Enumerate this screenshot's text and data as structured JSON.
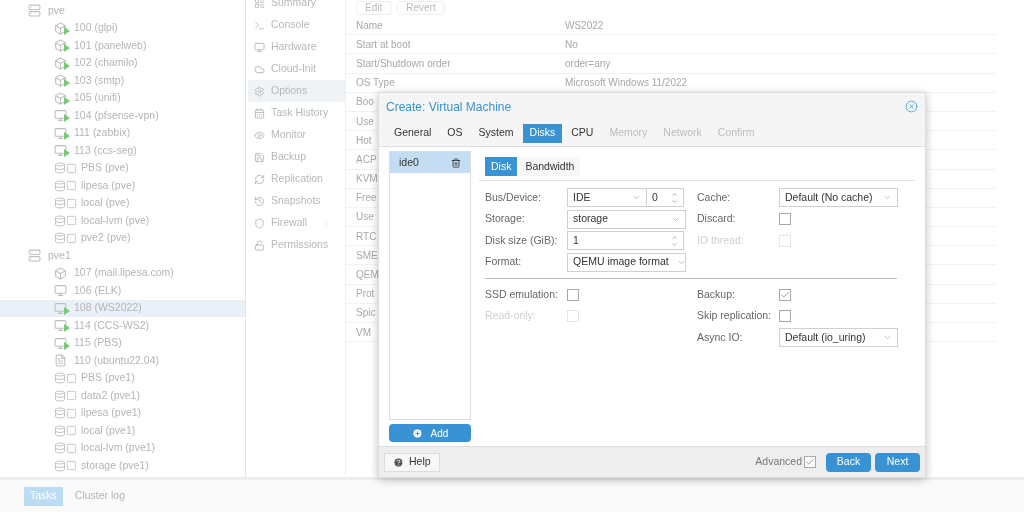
{
  "tree": [
    {
      "label": "pve",
      "kind": "node",
      "selected": false,
      "children": [
        {
          "label": "100 (glpi)",
          "kind": "container",
          "running": true,
          "selected": false
        },
        {
          "label": "101 (panelweb)",
          "kind": "container",
          "running": true,
          "selected": false
        },
        {
          "label": "102 (chamilo)",
          "kind": "container",
          "running": true,
          "selected": false
        },
        {
          "label": "103 (smtp)",
          "kind": "container",
          "running": true,
          "selected": false
        },
        {
          "label": "105 (unifi)",
          "kind": "container",
          "running": true,
          "selected": false
        },
        {
          "label": "104 (pfsense-vpn)",
          "kind": "vm",
          "running": true,
          "selected": false
        },
        {
          "label": "111 (zabbix)",
          "kind": "vm",
          "running": true,
          "selected": false
        },
        {
          "label": "113 (ccs-seg)",
          "kind": "vm",
          "running": true,
          "selected": false
        },
        {
          "label": "PBS (pve)",
          "kind": "storage",
          "selected": false
        },
        {
          "label": "lipesa (pve)",
          "kind": "storage",
          "selected": false
        },
        {
          "label": "local (pve)",
          "kind": "storage",
          "selected": false
        },
        {
          "label": "local-lvm (pve)",
          "kind": "storage",
          "selected": false
        },
        {
          "label": "pve2 (pve)",
          "kind": "storage",
          "selected": false
        }
      ]
    },
    {
      "label": "pve1",
      "kind": "node",
      "selected": false,
      "children": [
        {
          "label": "107 (mail.lipesa.com)",
          "kind": "container",
          "running": false,
          "selected": false
        },
        {
          "label": "106 (ELK)",
          "kind": "vm",
          "running": false,
          "selected": false
        },
        {
          "label": "108 (WS2022)",
          "kind": "vm",
          "running": true,
          "selected": true
        },
        {
          "label": "114 (CCS-WS2)",
          "kind": "vm",
          "running": true,
          "selected": false
        },
        {
          "label": "115 (PBS)",
          "kind": "vm",
          "running": true,
          "selected": false
        },
        {
          "label": "110 (ubuntu22.04)",
          "kind": "template",
          "selected": false
        },
        {
          "label": "PBS (pve1)",
          "kind": "storage",
          "selected": false
        },
        {
          "label": "data2 (pve1)",
          "kind": "storage",
          "selected": false
        },
        {
          "label": "lipesa (pve1)",
          "kind": "storage",
          "selected": false
        },
        {
          "label": "local (pve1)",
          "kind": "storage",
          "selected": false
        },
        {
          "label": "local-lvm (pve1)",
          "kind": "storage",
          "selected": false
        },
        {
          "label": "storage (pve1)",
          "kind": "storage",
          "selected": false
        }
      ]
    }
  ],
  "nav": [
    {
      "label": "Summary",
      "selected": false,
      "has_submenu": false
    },
    {
      "label": "Console",
      "selected": false,
      "has_submenu": false
    },
    {
      "label": "Hardware",
      "selected": false,
      "has_submenu": false
    },
    {
      "label": "Cloud-Init",
      "selected": false,
      "has_submenu": false
    },
    {
      "label": "Options",
      "selected": true,
      "has_submenu": false
    },
    {
      "label": "Task History",
      "selected": false,
      "has_submenu": false
    },
    {
      "label": "Monitor",
      "selected": false,
      "has_submenu": false
    },
    {
      "label": "Backup",
      "selected": false,
      "has_submenu": false
    },
    {
      "label": "Replication",
      "selected": false,
      "has_submenu": false
    },
    {
      "label": "Snapshots",
      "selected": false,
      "has_submenu": false
    },
    {
      "label": "Firewall",
      "selected": false,
      "has_submenu": true
    },
    {
      "label": "Permissions",
      "selected": false,
      "has_submenu": false
    }
  ],
  "toolbar": [
    "Edit",
    "Revert"
  ],
  "options": [
    {
      "name": "Name",
      "value": "WS2022"
    },
    {
      "name": "Start at boot",
      "value": "No"
    },
    {
      "name": "Start/Shutdown order",
      "value": "order=any"
    },
    {
      "name": "OS Type",
      "value": "Microsoft Windows 11/2022"
    },
    {
      "name": "Boo"
    },
    {
      "name": "Use"
    },
    {
      "name": "Hot"
    },
    {
      "name": "ACP"
    },
    {
      "name": "KVM"
    },
    {
      "name": "Free"
    },
    {
      "name": "Use"
    },
    {
      "name": "RTC"
    },
    {
      "name": "SME"
    },
    {
      "name": "QEM"
    },
    {
      "name": "Prot"
    },
    {
      "name": "Spic"
    },
    {
      "name": "VM"
    }
  ],
  "dialog": {
    "title": "Create: Virtual Machine",
    "tabs": [
      {
        "label": "General",
        "selected": false,
        "disabled": false
      },
      {
        "label": "OS",
        "selected": false,
        "disabled": false
      },
      {
        "label": "System",
        "selected": false,
        "disabled": false
      },
      {
        "label": "Disks",
        "selected": true,
        "disabled": false
      },
      {
        "label": "CPU",
        "selected": false,
        "disabled": false
      },
      {
        "label": "Memory",
        "selected": false,
        "disabled": true
      },
      {
        "label": "Network",
        "selected": false,
        "disabled": true
      },
      {
        "label": "Confirm",
        "selected": false,
        "disabled": true
      }
    ],
    "disks": [
      {
        "label": "ide0",
        "selected": true
      }
    ],
    "add_button": "Add",
    "subtabs": [
      {
        "label": "Disk",
        "selected": true
      },
      {
        "label": "Bandwidth",
        "selected": false
      }
    ],
    "general": [
      [
        {
          "label": "Bus/Device:",
          "kind": "bus",
          "value": "IDE",
          "index": "0"
        },
        {
          "label": "Storage:",
          "kind": "select",
          "value": "storage"
        },
        {
          "label": "Disk size (GiB):",
          "kind": "spin",
          "value": "1"
        },
        {
          "label": "Format:",
          "kind": "select",
          "value": "QEMU image format"
        }
      ],
      [
        {
          "label": "Cache:",
          "kind": "select",
          "value": "Default (No cache)"
        },
        {
          "label": "Discard:",
          "kind": "checkbox",
          "checked": false,
          "disabled": false
        },
        {
          "label": "IO thread:",
          "kind": "checkbox",
          "checked": false,
          "disabled": true
        }
      ]
    ],
    "advanced": [
      [
        {
          "label": "SSD emulation:",
          "kind": "checkbox",
          "checked": false,
          "disabled": false
        },
        {
          "label": "Read-only:",
          "kind": "checkbox",
          "checked": false,
          "disabled": true
        }
      ],
      [
        {
          "label": "Backup:",
          "kind": "checkbox",
          "checked": true,
          "disabled": false
        },
        {
          "label": "Skip replication:",
          "kind": "checkbox",
          "checked": false,
          "disabled": false
        },
        {
          "label": "Async IO:",
          "kind": "select",
          "value": "Default (io_uring)"
        }
      ]
    ],
    "help_button": "Help",
    "advanced_toggle": {
      "label": "Advanced",
      "checked": true
    },
    "buttons": [
      "Back",
      "Next"
    ]
  },
  "bottom_tabs": [
    {
      "label": "Tasks",
      "selected": true
    },
    {
      "label": "Cluster log",
      "selected": false
    }
  ]
}
